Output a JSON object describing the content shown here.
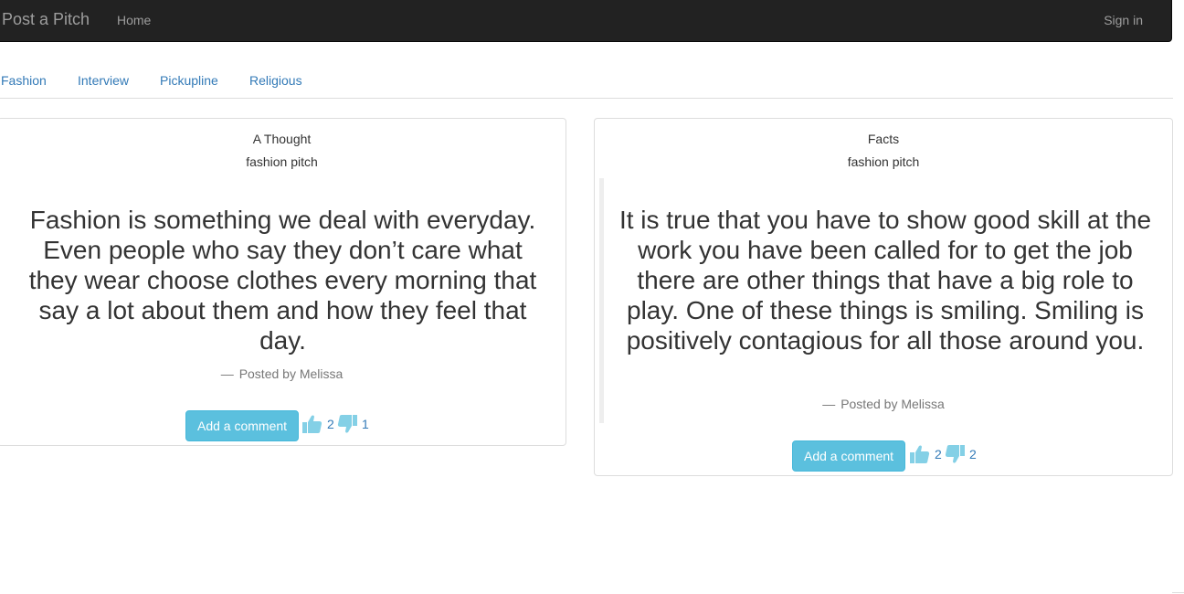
{
  "navbar": {
    "brand": "Post a Pitch",
    "home_label": "Home",
    "signin_label": "Sign in"
  },
  "tabs": [
    {
      "label": "Fashion"
    },
    {
      "label": "Interview"
    },
    {
      "label": "Pickupline"
    },
    {
      "label": "Religious"
    }
  ],
  "pitches": [
    {
      "title": "A Thought",
      "category": "fashion pitch",
      "text": "Fashion is something we deal with everyday. Even people who say they don’t care what they wear choose clothes every morning that say a lot about them and how they feel that day.",
      "author_prefix": "—",
      "author": "Posted by Melissa",
      "comment_label": "Add a comment",
      "upvotes": "2",
      "downvotes": "1"
    },
    {
      "title": "Facts",
      "category": "fashion pitch",
      "text": "It is true that you have to show good skill at the work you have been called for to get the job there are other things that have a big role to play. One of these things is smiling. Smiling is positively contagious for all those around you.",
      "author_prefix": "—",
      "author": "Posted by Melissa",
      "comment_label": "Add a comment",
      "upvotes": "2",
      "downvotes": "2"
    }
  ],
  "icons": {
    "upvote": "thumbs-up-icon",
    "downvote": "thumbs-down-icon"
  },
  "colors": {
    "navbar_bg": "#222222",
    "link": "#337ab7",
    "info_button": "#5bc0de",
    "vote_icon": "#5bc0de"
  }
}
